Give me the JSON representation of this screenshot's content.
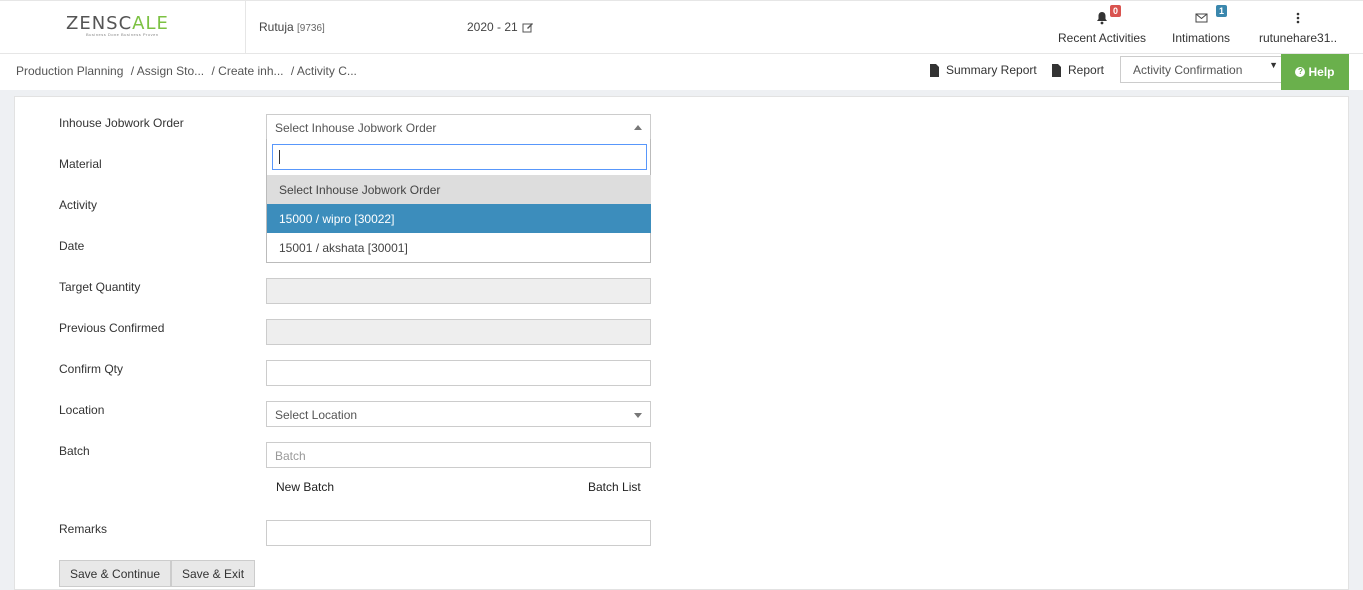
{
  "brand": {
    "logo_left": "ZENSC",
    "logo_accent": "A",
    "logo_right": "LE",
    "tagline": "Business Done Business Proven"
  },
  "header": {
    "user": "Rutuja",
    "user_code": "[9736]",
    "financial_year": "2020 - 21",
    "recent_activities": {
      "label": "Recent Activities",
      "count": "0"
    },
    "intimations": {
      "label": "Intimations",
      "count": "1"
    },
    "account": {
      "label": "rutunehare31.."
    }
  },
  "subheader": {
    "breadcrumb": [
      "Production Planning",
      "/ Assign Sto...",
      "/ Create inh...",
      "/ Activity C..."
    ],
    "summary_report": "Summary Report",
    "report": "Report",
    "activity_select": "Activity Confirmation",
    "help": "Help"
  },
  "form": {
    "labels": {
      "inhouse_jobwork_order": "Inhouse Jobwork Order",
      "material": "Material",
      "activity": "Activity",
      "date": "Date",
      "target_quantity": "Target Quantity",
      "previous_confirmed": "Previous Confirmed",
      "confirm_qty": "Confirm Qty",
      "location": "Location",
      "batch": "Batch",
      "remarks": "Remarks"
    },
    "jobwork_select": "Select Inhouse Jobwork Order",
    "jobwork_options": [
      "Select Inhouse Jobwork Order",
      "15000 / wipro [30022]",
      "15001 / akshata [30001]"
    ],
    "location_select": "Select Location",
    "batch_placeholder": "Batch",
    "new_batch": "New Batch",
    "batch_list": "Batch List",
    "save_continue": "Save & Continue",
    "save_exit": "Save & Exit"
  },
  "colors": {
    "accent_green": "#6ab04c",
    "highlight_blue": "#3c8dbc",
    "badge_red": "#d9534f",
    "badge_blue": "#3a87ad"
  }
}
